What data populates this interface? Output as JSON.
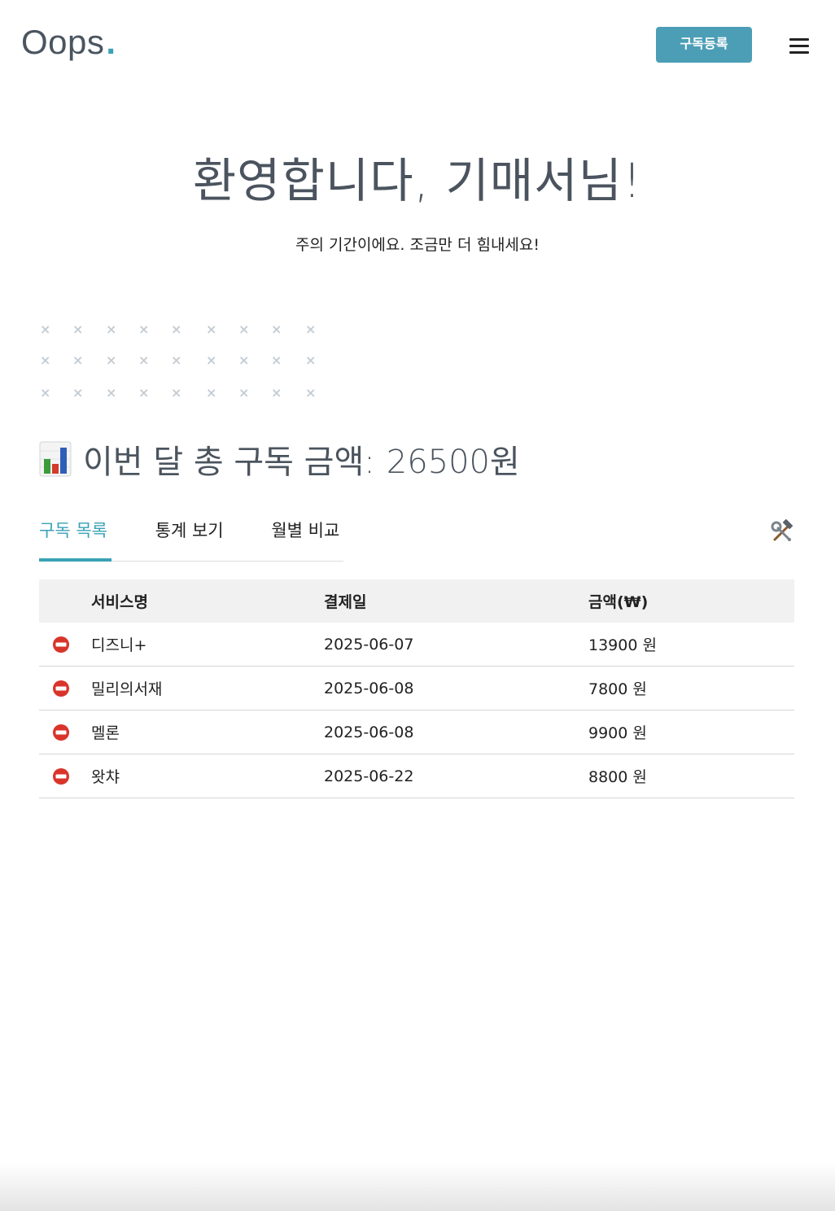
{
  "header": {
    "logo_text": "Oops",
    "logo_dot": ".",
    "register_label": "구독등록",
    "menu_icon": "hamburger-menu-icon"
  },
  "hero": {
    "title": "환영합니다, 기매서님!",
    "subtitle": "주의 기간이에요. 조금만 더 힘내세요!"
  },
  "total": {
    "icon": "bar-chart-icon",
    "label": "이번 달 총 구독 금액:",
    "amount": "26500원"
  },
  "tabs": [
    {
      "label": "구독 목록",
      "active": true
    },
    {
      "label": "통계 보기",
      "active": false
    },
    {
      "label": "월별 비교",
      "active": false
    }
  ],
  "tools_icon": "hammer-wrench-icon",
  "table": {
    "headers": [
      "서비스명",
      "결제일",
      "금액(₩)"
    ],
    "rows": [
      {
        "name": "디즈니+",
        "date": "2025-06-07",
        "amount": "13900 원"
      },
      {
        "name": "밀리의서재",
        "date": "2025-06-08",
        "amount": "7800 원"
      },
      {
        "name": "멜론",
        "date": "2025-06-08",
        "amount": "9900 원"
      },
      {
        "name": "왓챠",
        "date": "2025-06-22",
        "amount": "8800 원"
      }
    ],
    "row_icon": "no-entry-icon"
  },
  "colors": {
    "accent": "#3aa2b5",
    "button": "#4b9eb6",
    "heading": "#4b545e",
    "no_entry": "#d9342b"
  }
}
